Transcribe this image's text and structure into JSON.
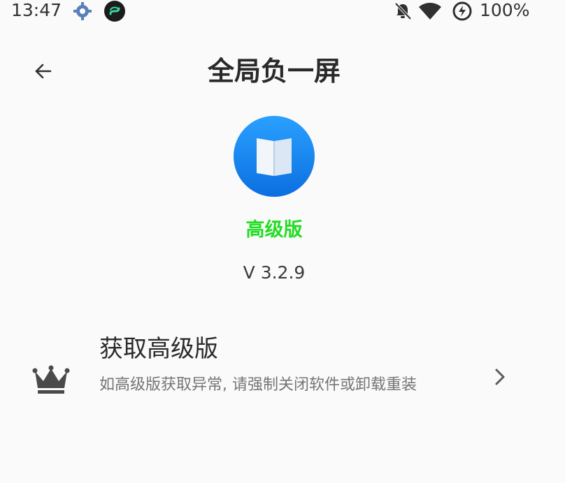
{
  "status_bar": {
    "time": "13:47",
    "battery": "100%",
    "icons": [
      "settings-icon",
      "app-notification-icon",
      "notifications-off-icon",
      "wifi-icon",
      "battery-saver-icon"
    ]
  },
  "app_bar": {
    "title": "全局负一屏",
    "back_icon": "arrow-back-icon"
  },
  "app_info": {
    "edition": "高级版",
    "edition_color": "#22dd22",
    "version": "V 3.2.9",
    "icon_color": "#1a86f0"
  },
  "premium_row": {
    "title": "获取高级版",
    "description": "如高级版获取异常, 请强制关闭软件或卸载重装",
    "icon": "crown-icon",
    "trailing_icon": "chevron-right-icon"
  }
}
